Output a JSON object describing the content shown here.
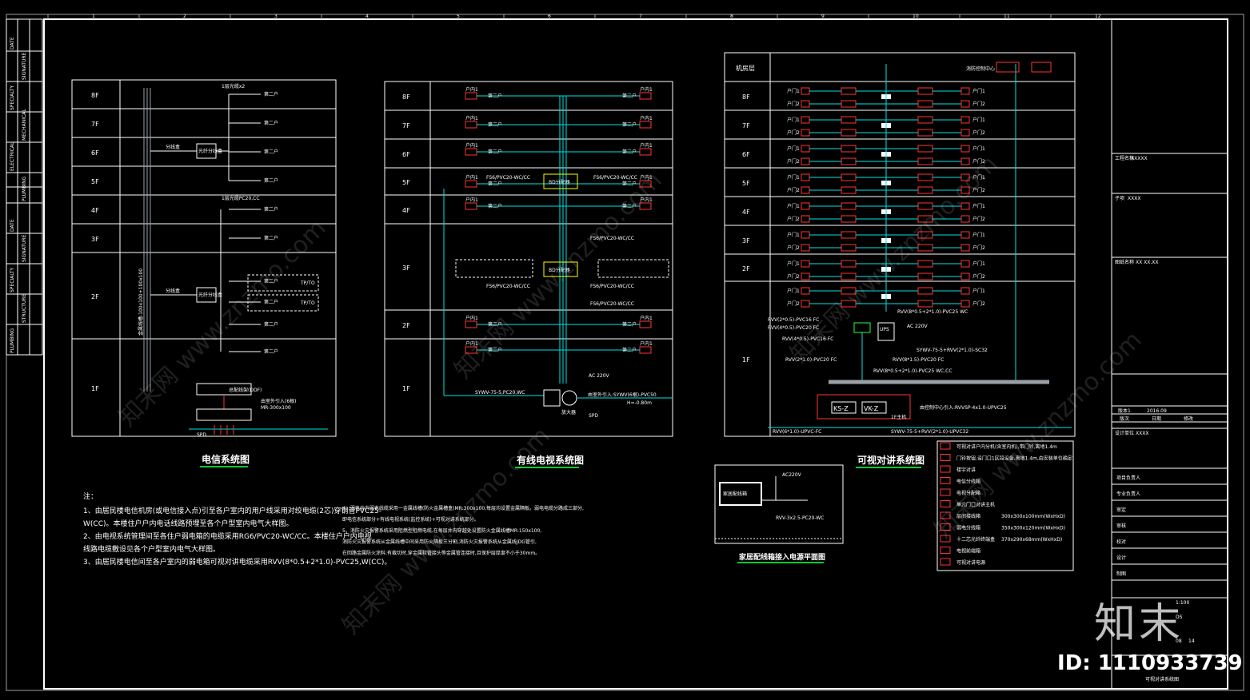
{
  "colors": {
    "frame": "#ffffff",
    "cyan": "#00e5e5",
    "red": "#ff3333",
    "yellow": "#ffff00",
    "green": "#22ff44",
    "grey": "#9aa0a6",
    "title_underline": "#00cc33"
  },
  "left_strip": {
    "cells": [
      "DATE",
      "SIGNATURE",
      "SPECIALTY",
      "MECHANICAL",
      "ELECTRICAL",
      "PLUMBING",
      "DATE",
      "SIGNATURE",
      "SPECIALTY",
      "STRUCTURE",
      "PLUMBING"
    ]
  },
  "grid_marks": [
    "1",
    "2",
    "3",
    "4",
    "5",
    "6",
    "7",
    "8",
    "9",
    "10",
    "11",
    "12"
  ],
  "telecom": {
    "title": "电信系统图",
    "floors": [
      "8F",
      "7F",
      "6F",
      "5F",
      "4F",
      "3F",
      "2F",
      "1F"
    ],
    "labels": {
      "top_cable": "1层光缆x2",
      "mid_cable": "1层光缆PC20,CC",
      "box1": "光纤分线盒",
      "box2": "光纤分线盒",
      "ddf": "总配线架(DDF)",
      "mr": "MR-300x100",
      "entry": "由室外引入(6根)",
      "spd": "SPD",
      "riser": "金属线槽-100x100+100x100",
      "dist1": "分线盒",
      "dist2": "分线盒",
      "port": "TP/TO"
    },
    "tenant": "第二户"
  },
  "catv": {
    "title": "有线电视系统图",
    "floors": [
      "8F",
      "7F",
      "6F",
      "5F",
      "4F",
      "3F",
      "2F",
      "1F"
    ],
    "labels": {
      "bd5": "BD分配器",
      "bd3": "BD分配器",
      "cable1": "SYWV-75-5,PC20,WC",
      "cable2": "由室外引入:SYWV(6根)-PVC50",
      "ac": "AC 220V",
      "spd": "SPD",
      "amp": "放大器",
      "depth": "H=-0.80m",
      "r5l": "FS6/PVC20-WC/CC",
      "r5r": "FS6/PVC20-WC/CC",
      "r3": "FS6/PVC20-WC/CC",
      "r3b": "FS6/PVC20-WC/CC",
      "r3c": "FS6/PVC20-WC/CC",
      "r3d": "FS6/PVC20-WC/CC"
    },
    "outlet": "户内1",
    "tenant": "第二户"
  },
  "intercom": {
    "title": "可视对讲系统图",
    "floors": [
      "机房层",
      "8F",
      "7F",
      "6F",
      "5F",
      "4F",
      "3F",
      "2F",
      "1F"
    ],
    "labels": {
      "rvv_top": "RVV(8*0.5+2*1.0)-PVC25 WC",
      "rvv1": "RVV(2*0.5)-PVC16 FC",
      "rvv2": "RVV(4*0.5)-PVC20 FC",
      "rvv3": "RVV(4*0.5)-PVC16 FC",
      "ac": "AC 220V",
      "sywv": "SYWV-75-5+RVV(2*1.0)-SC32",
      "rvv4": "RVV(8*1.5)-PVC20 FC",
      "rvv5": "RVV(2*1.0)-PVC20 FC",
      "rvv6": "RVV(8*0.5+2*1.0)-PVC25 WC,CC",
      "ksz": "KS-Z",
      "vkz": "VK-Z",
      "fl1": "1F主机",
      "ops": "UPS",
      "bottom1": "RVV(6*1.0)-UPVC-FC",
      "bottom2": "SYWV-75-5+RVV(2*1.0)-UPVC32",
      "bottom3": "由控制中心引入:RVVSP-4x1.0-UPVC25",
      "machine": "消防控制中心"
    },
    "unit": "户门1",
    "unit2": "户门2"
  },
  "panel_plan": {
    "title": "家居配线箱接入电源平面图",
    "ac": "AC220V",
    "label": "家居配线箱",
    "cable": "RVV-3x2.5-PC20-WC"
  },
  "notes": {
    "head": "注：",
    "col1": [
      "1、由居民楼电信机房(或电信接入点)引至各户室内的用户线采用对绞电缆(2芯)穿钢管PVC25-",
      "W(CC)。本楼住户户内电话线路预埋至各个户型室内电气大样图。",
      "2、由电视系统管理间至各住户弱电箱的电缆采用RG6/PVC20-WC/CC。本楼住户户内电视",
      "线路电缆敷设见各个户型室内电气大样图。",
      "3、由居民楼电信间至各户室内的弱电箱可视对讲电缆采用RVV(8*0.5+2*1.0)-PVC25,W(CC)。"
    ],
    "col2": [
      "4、弱电井内弱电线缆采用一金属线槽(防火金属槽盒)MR:300x100,每层均设置金属隔板。弱电电缆分路成三部分,",
      "  即电信系统部分+有线电视系统(监控系统)+可视对讲系统部分。",
      "5、消防火灾报警系统采用阻燃型阻燃电缆,在每层井内穿越处设置防火金属线槽MR:150x100,",
      "  消防火灾报警系统从金属线槽中间采用防火隔板三分割,消防火灾报警系统从金属线JDG管引,",
      "  在回路金属防火涂料;有裁切时,穿金属软管接头等金属管连接时,且保护层厚度不小于30mm。"
    ]
  },
  "legend": [
    {
      "sym": "户",
      "text": "可视对讲户内分机(含室内机),带门铃,离地1.4m"
    },
    {
      "sym": "⊙",
      "text": "门铃按钮,设门口1区段设备,离地1.4m,由安装单位确定"
    },
    {
      "sym": "户",
      "text": "楼宇对讲"
    },
    {
      "sym": "▭",
      "text": "电信分线箱"
    },
    {
      "sym": "▭",
      "text": "电视分配箱"
    },
    {
      "sym": "▭",
      "text": "单元门口对讲主机"
    },
    {
      "sym": "▭",
      "text": "层间接线箱",
      "dim": "300x300x100mm(WxHxD)"
    },
    {
      "sym": "▭",
      "text": "弱电分线箱",
      "dim": "350x300x120mm(WxHxD)"
    },
    {
      "sym": "▭",
      "text": "十二芯光纤终端盒",
      "dim": "370x290x68mm(WxHxD)"
    },
    {
      "sym": "▭",
      "text": "电视前端箱"
    },
    {
      "sym": "▭",
      "text": "可视对讲电源"
    }
  ],
  "title_block": {
    "project_label": "工程名称",
    "project": "XXXXX",
    "sub_label": "子项",
    "sub": "XXXX",
    "drawing_label": "图纸名称",
    "drawing": "XX XX.XX",
    "rev": "版本1",
    "date": "2016.09",
    "rows": [
      "版次",
      "日期",
      "修改"
    ],
    "sheet_label": "设计单位",
    "sheet": "XXXX",
    "fields": [
      "项目负责人",
      "专业负责人",
      "审定",
      "审核",
      "校对",
      "设计",
      "制图"
    ],
    "scale": "1:100",
    "no": "DS",
    "page": "08",
    "total": "14",
    "name": "可视对讲系统图"
  },
  "watermark": "知末网 www.znzmo.com",
  "brand": "知末",
  "id_text": "ID: 1110933739"
}
